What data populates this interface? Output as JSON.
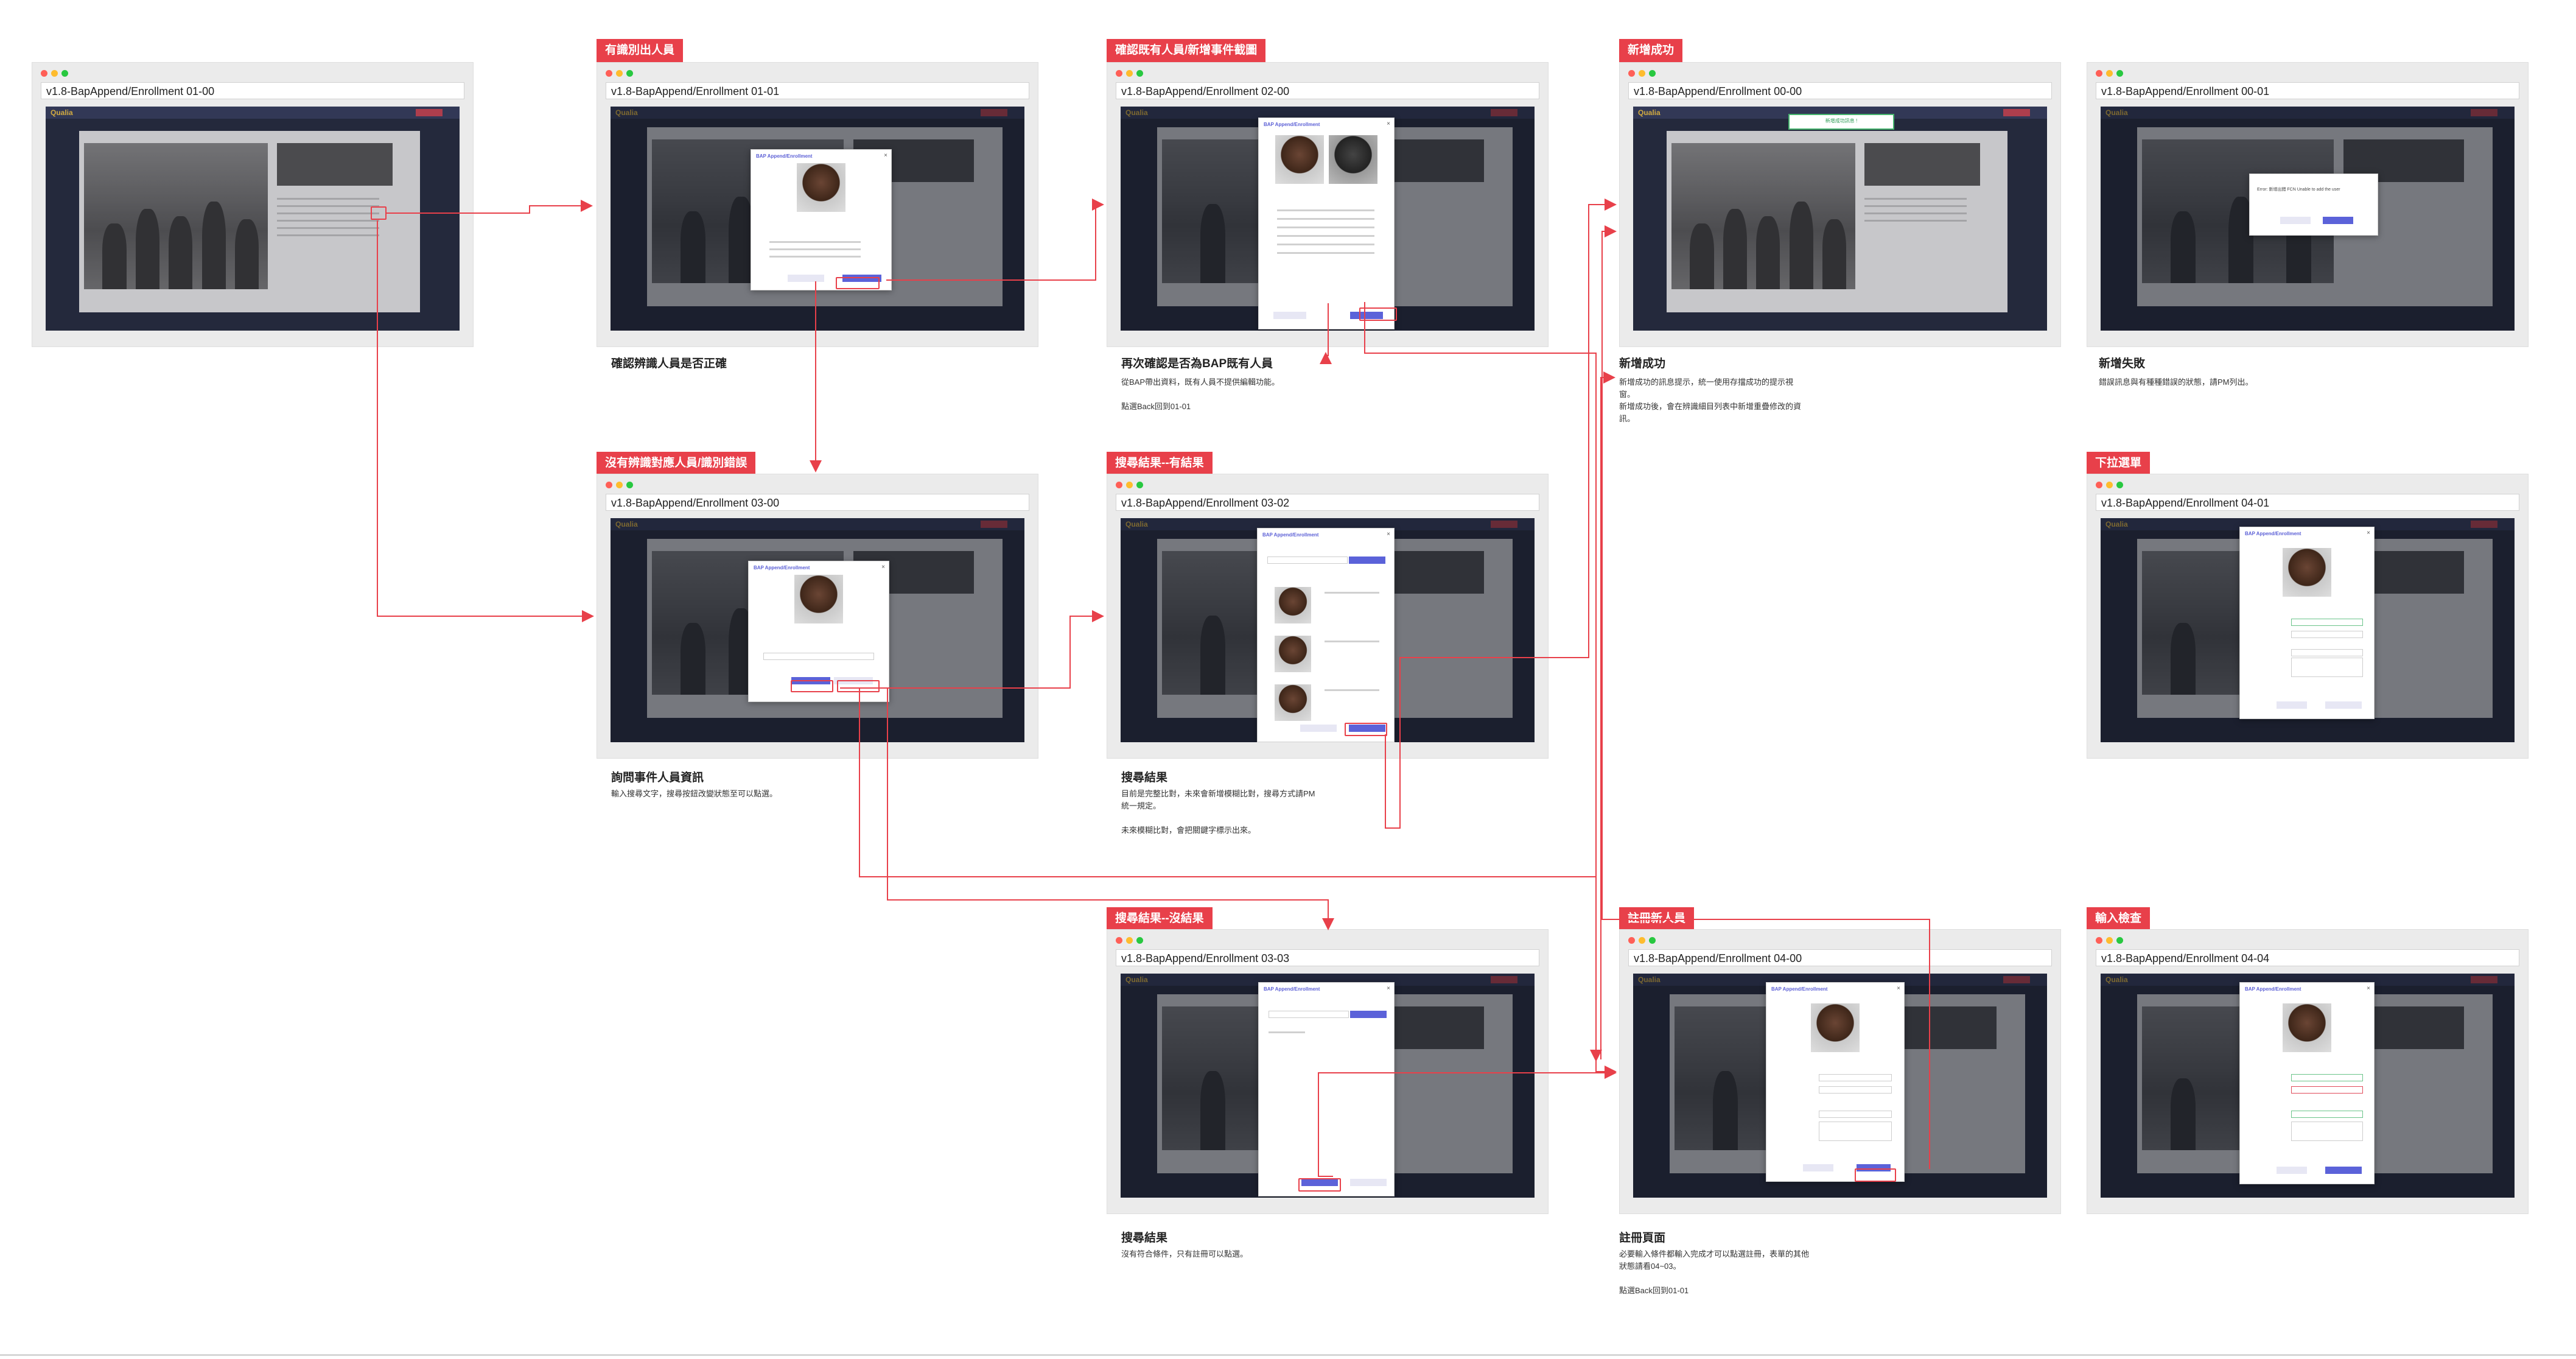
{
  "screens": {
    "s0100": {
      "address": "v1.8-BapAppend/Enrollment 01-00"
    },
    "s0101": {
      "tag": "有識別出人員",
      "address": "v1.8-BapAppend/Enrollment 01-01",
      "caption_title": "確認辨識人員是否正確",
      "caption_body": ""
    },
    "s0200": {
      "tag": "確認既有人員/新增事件截圖",
      "address": "v1.8-BapAppend/Enrollment 02-00",
      "caption_title": "再次確認是否為BAP既有人員",
      "caption_body": "從BAP帶出資料，既有人員不提供編輯功能。\n\n點選Back回到01-01"
    },
    "s0000": {
      "tag": "新增成功",
      "address": "v1.8-BapAppend/Enrollment 00-00",
      "caption_title": "新增成功",
      "caption_body": "新增成功的訊息提示，統一使用存擋成功的提示視窗。\n新增成功後，會在辨識細目列表中新增重疊修改的資訊。",
      "toast": "新增成功訊息 !"
    },
    "s0001": {
      "address": "v1.8-BapAppend/Enrollment 00-01",
      "caption_title": "新增失敗",
      "caption_body": "錯誤訊息與有種種錯誤的狀態，請PM列出。",
      "alert_text": "Error: 新增出錯 FCN Unable to add the user"
    },
    "s0300": {
      "tag": "沒有辨識對應人員/識別錯誤",
      "address": "v1.8-BapAppend/Enrollment 03-00",
      "caption_title": "詢問事件人員資訊",
      "caption_body": "輸入搜尋文字，搜尋按鈕改變狀態至可以點選。"
    },
    "s0302": {
      "tag": "搜尋結果--有結果",
      "address": "v1.8-BapAppend/Enrollment 03-02",
      "caption_title": "搜尋結果",
      "caption_body": "目前是完整比對，未來會新增模糊比對，搜尋方式請PM統一規定。\n\n未來模糊比對，會把關鍵字標示出來。"
    },
    "s0401": {
      "tag": "下拉選單",
      "address": "v1.8-BapAppend/Enrollment 04-01"
    },
    "s0303": {
      "tag": "搜尋結果--沒結果",
      "address": "v1.8-BapAppend/Enrollment 03-03",
      "caption_title": "搜尋結果",
      "caption_body": "沒有符合條件，只有註冊可以點選。"
    },
    "s0400": {
      "tag": "註冊新人員",
      "address": "v1.8-BapAppend/Enrollment 04-00",
      "caption_title": "註冊頁面",
      "caption_body": "必要輸入條件都輸入完成才可以點選註冊，表單的其他狀態請看04~03。\n\n點選Back回到01-01"
    },
    "s0404": {
      "tag": "輸入檢查",
      "address": "v1.8-BapAppend/Enrollment 04-04"
    }
  },
  "modal": {
    "title": "BAP Append/Enrollment",
    "close": "×"
  },
  "app_logo": "Qualia",
  "colors": {
    "tag": "#e8404a",
    "connector": "#e8404a",
    "primary": "#5b62d9",
    "success": "#46b46e"
  }
}
